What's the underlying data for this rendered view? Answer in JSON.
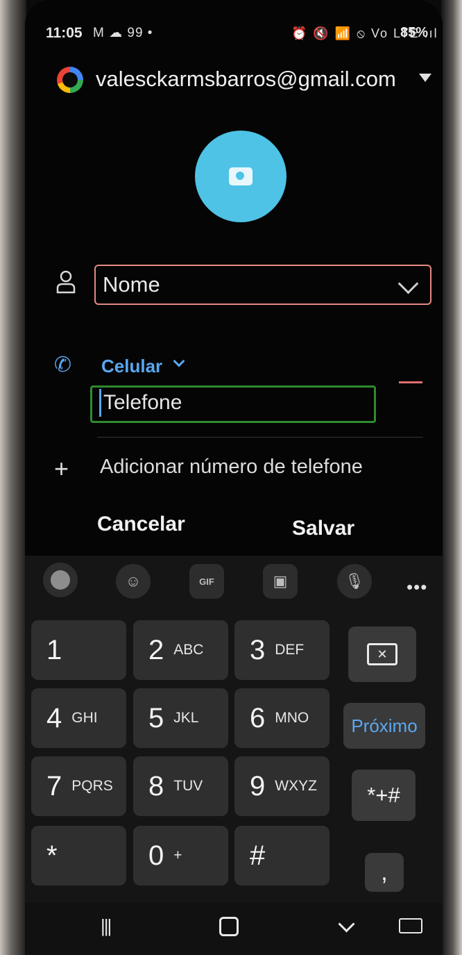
{
  "status_bar": {
    "time": "11:05",
    "left_icons": "M ☁ 99 •",
    "right_icons": "⏰ 🔇 📶 ⦸ Vo LTE .ıl",
    "battery": "85%"
  },
  "account": {
    "email": "valesckarmsbarros@gmail.com"
  },
  "form": {
    "name_placeholder": "Nome",
    "phone_type": "Celular",
    "phone_placeholder": "Telefone",
    "add_phone_label": "Adicionar número de telefone"
  },
  "actions": {
    "cancel_label": "Cancelar",
    "save_label": "Salvar"
  },
  "keyboard": {
    "more_label": "•••",
    "keys": [
      {
        "num": "1",
        "letters": ""
      },
      {
        "num": "2",
        "letters": "ABC"
      },
      {
        "num": "3",
        "letters": "DEF"
      },
      {
        "num": "4",
        "letters": "GHI"
      },
      {
        "num": "5",
        "letters": "JKL"
      },
      {
        "num": "6",
        "letters": "MNO"
      },
      {
        "num": "7",
        "letters": "PQRS"
      },
      {
        "num": "8",
        "letters": "TUV"
      },
      {
        "num": "9",
        "letters": "WXYZ"
      },
      {
        "num": "*",
        "letters": ""
      },
      {
        "num": "0",
        "letters": "+"
      },
      {
        "num": "#",
        "letters": ""
      }
    ],
    "next_label": "Próximo",
    "symbols_label": "*+#",
    "comma_label": ","
  },
  "colors": {
    "accent": "#5aa8f0",
    "photo": "#4fc3e6",
    "name_border": "#e58a84",
    "phone_border": "#2e8b2e"
  }
}
